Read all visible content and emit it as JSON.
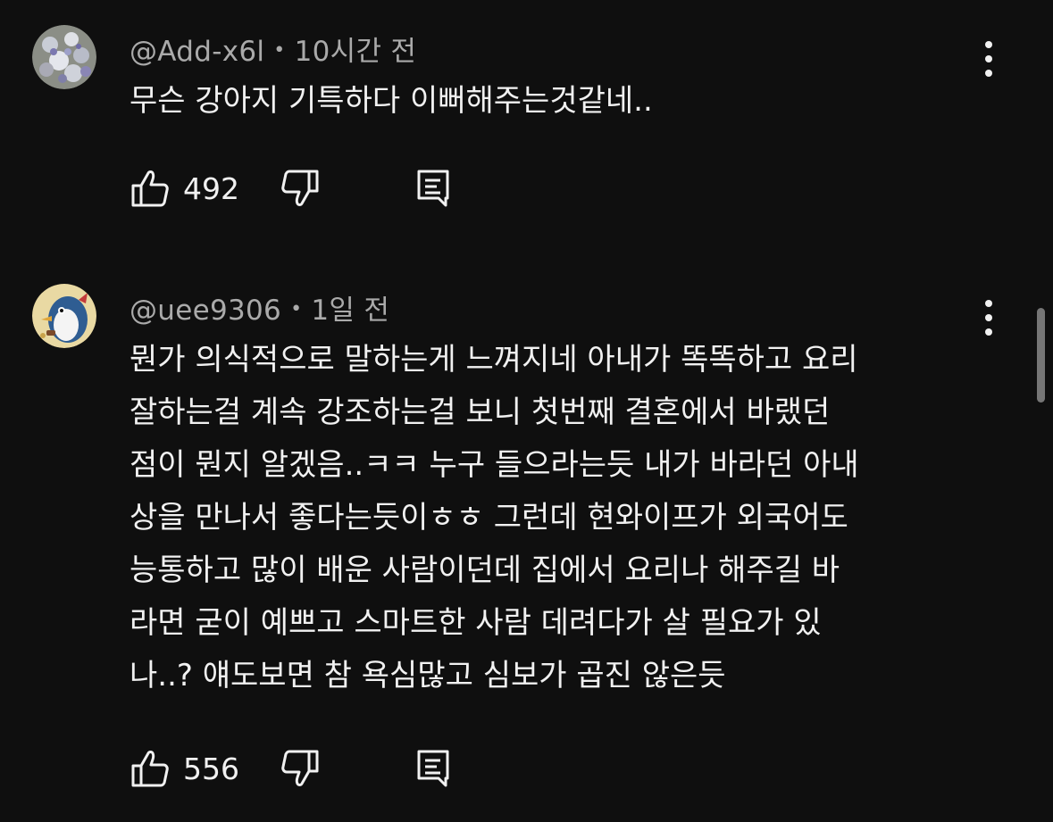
{
  "comments": [
    {
      "author": "@Add-x6l",
      "separator": "•",
      "time": "10시간 전",
      "text": "무슨 강아지 기특하다 이뻐해주는것같네..",
      "likes": "492",
      "avatar_icon": "avatar-flowers",
      "more_icon": "kebab-menu-icon"
    },
    {
      "author": "@uee9306",
      "separator": "•",
      "time": "1일 전",
      "text": "뭔가 의식적으로 말하는게 느껴지네 아내가 똑똑하고 요리\n잘하는걸 계속 강조하는걸 보니 첫번째 결혼에서 바랬던\n점이 뭔지 알겠음..ㅋㅋ 누구 들으라는듯 내가 바라던 아내\n상을 만나서 좋다는듯이ㅎㅎ 그런데 현와이프가 외국어도\n능통하고 많이 배운 사람이던데 집에서 요리나 해주길 바\n라면 굳이 예쁘고 스마트한 사람 데려다가 살 필요가 있\n나..? 얘도보면 참 욕심많고 심보가 곱진 않은듯",
      "likes": "556",
      "avatar_icon": "avatar-penguin",
      "more_icon": "kebab-menu-icon"
    }
  ],
  "colors": {
    "background": "#0f0f0f",
    "text_primary": "#f1f1f1",
    "text_secondary": "#aaaaaa"
  }
}
